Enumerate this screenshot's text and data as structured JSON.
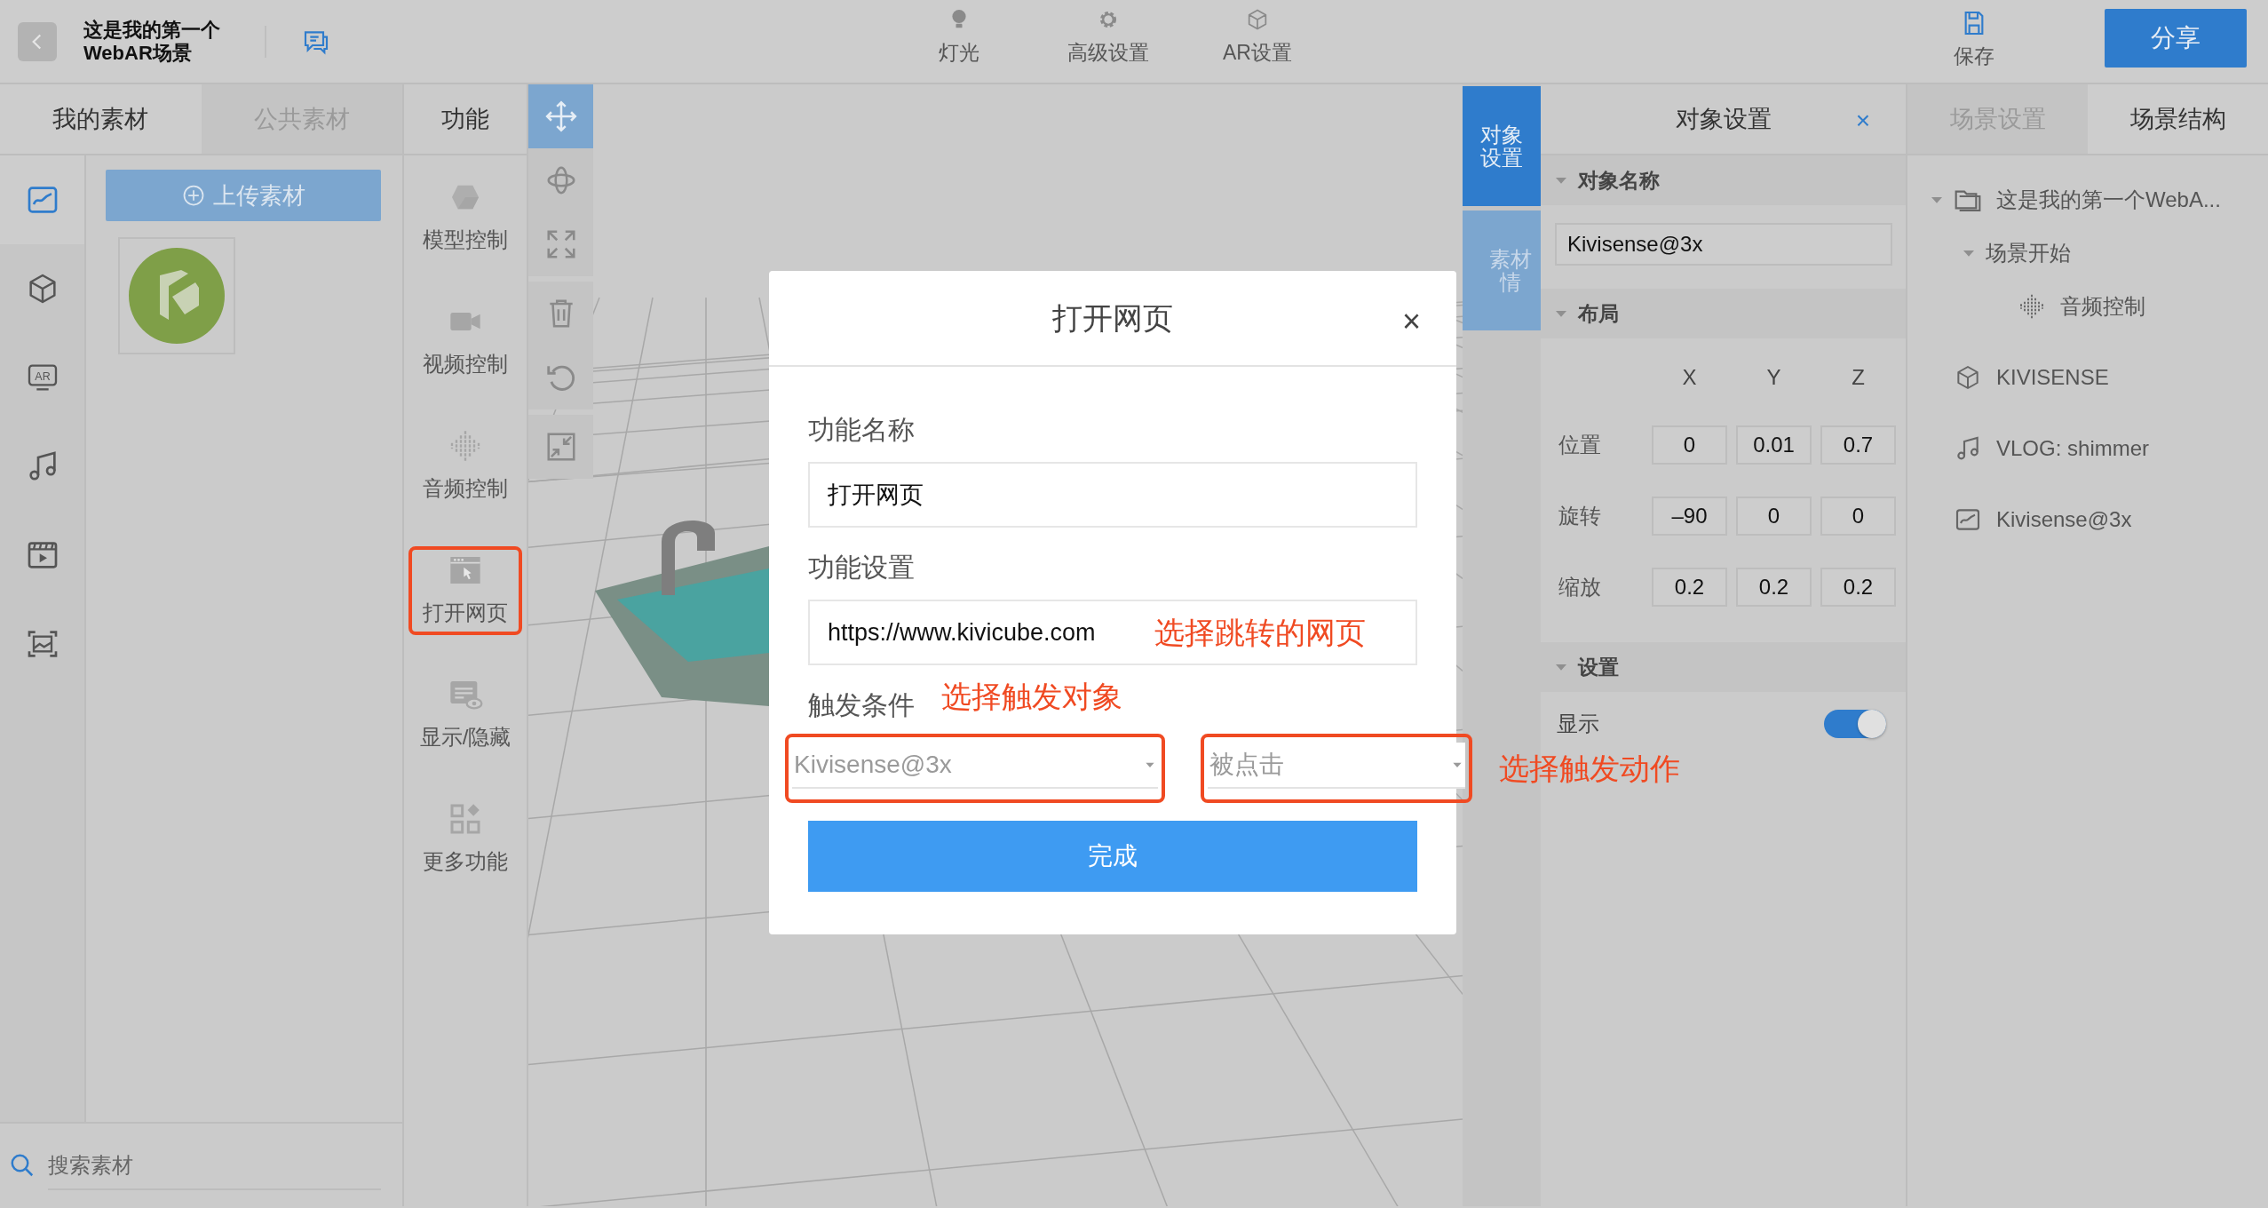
{
  "header": {
    "title_lines": [
      "这是我的第一个",
      "WebAR场景"
    ]
  },
  "top_menu": [
    {
      "label": "灯光"
    },
    {
      "label": "高级设置"
    },
    {
      "label": "AR设置"
    }
  ],
  "save_label": "保存",
  "share_label": "分享",
  "asset_tabs": [
    {
      "label": "我的素材",
      "selected": true
    },
    {
      "label": "公共素材",
      "selected": false
    }
  ],
  "asset_categories": [
    {
      "selected": true
    },
    {
      "selected": false
    },
    {
      "text": "AR",
      "selected": false
    },
    {
      "selected": false
    },
    {
      "selected": false
    },
    {
      "selected": false
    }
  ],
  "upload_label": "上传素材",
  "search": {
    "placeholder": "搜索素材"
  },
  "function_panel": {
    "title": "功能",
    "items": [
      {
        "label": "模型控制",
        "annotated": false
      },
      {
        "label": "视频控制",
        "annotated": false
      },
      {
        "label": "音频控制",
        "annotated": false
      },
      {
        "label": "打开网页",
        "annotated": true
      },
      {
        "label": "显示/隐藏",
        "annotated": false
      },
      {
        "label": "更多功能",
        "annotated": false
      }
    ]
  },
  "tools": [
    {
      "selected": true
    },
    {
      "selected": false
    },
    {
      "selected": false
    },
    {
      "selected": false
    },
    {
      "selected": false
    },
    {
      "selected": false
    }
  ],
  "object_tabs": [
    {
      "lines": [
        "对象",
        "设置"
      ],
      "selected": true
    },
    {
      "lines": [
        "素材",
        "情"
      ],
      "selected": false
    }
  ],
  "object_panel": {
    "title": "对象设置",
    "close": "×",
    "name_section": {
      "title": "对象名称",
      "expanded": true,
      "value": "Kivisense@3x"
    },
    "layout_section": {
      "title": "布局",
      "expanded": true,
      "axes": [
        "X",
        "Y",
        "Z"
      ],
      "rows": [
        {
          "label": "位置",
          "values": [
            "0",
            "0.01",
            "0.7"
          ]
        },
        {
          "label": "旋转",
          "values": [
            "–90",
            "0",
            "0"
          ]
        },
        {
          "label": "缩放",
          "values": [
            "0.2",
            "0.2",
            "0.2"
          ]
        }
      ]
    },
    "settings_section": {
      "title": "设置",
      "expanded": true,
      "rows": [
        {
          "label": "显示",
          "on": true
        }
      ]
    }
  },
  "scene_tabs": [
    {
      "label": "场景设置",
      "selected": false
    },
    {
      "label": "场景结构",
      "selected": true
    }
  ],
  "scene_tree": [
    {
      "label": "这是我的第一个WebA...",
      "kind": "scene",
      "expanded": true,
      "children": [
        {
          "label": "场景开始",
          "expanded": true,
          "children": [
            {
              "label": "音频控制",
              "kind": "audio"
            }
          ]
        }
      ]
    },
    {
      "label": "KIVISENSE",
      "kind": "model"
    },
    {
      "label": "VLOG: shimmer",
      "kind": "music"
    },
    {
      "label": "Kivisense@3x",
      "kind": "image"
    }
  ],
  "modal": {
    "title": "打开网页",
    "close": "×",
    "fields": [
      {
        "label": "功能名称",
        "value": "打开网页"
      },
      {
        "label": "功能设置",
        "value": "https://www.kivicube.com"
      }
    ],
    "trigger": {
      "label": "触发条件",
      "selects": [
        {
          "value": "Kivisense@3x",
          "annotated": true
        },
        {
          "value": "被点击",
          "annotated": true
        }
      ]
    },
    "submit": "完成"
  },
  "annotations": [
    "选择跳转的网页",
    "选择触发对象",
    "选择触发动作"
  ]
}
